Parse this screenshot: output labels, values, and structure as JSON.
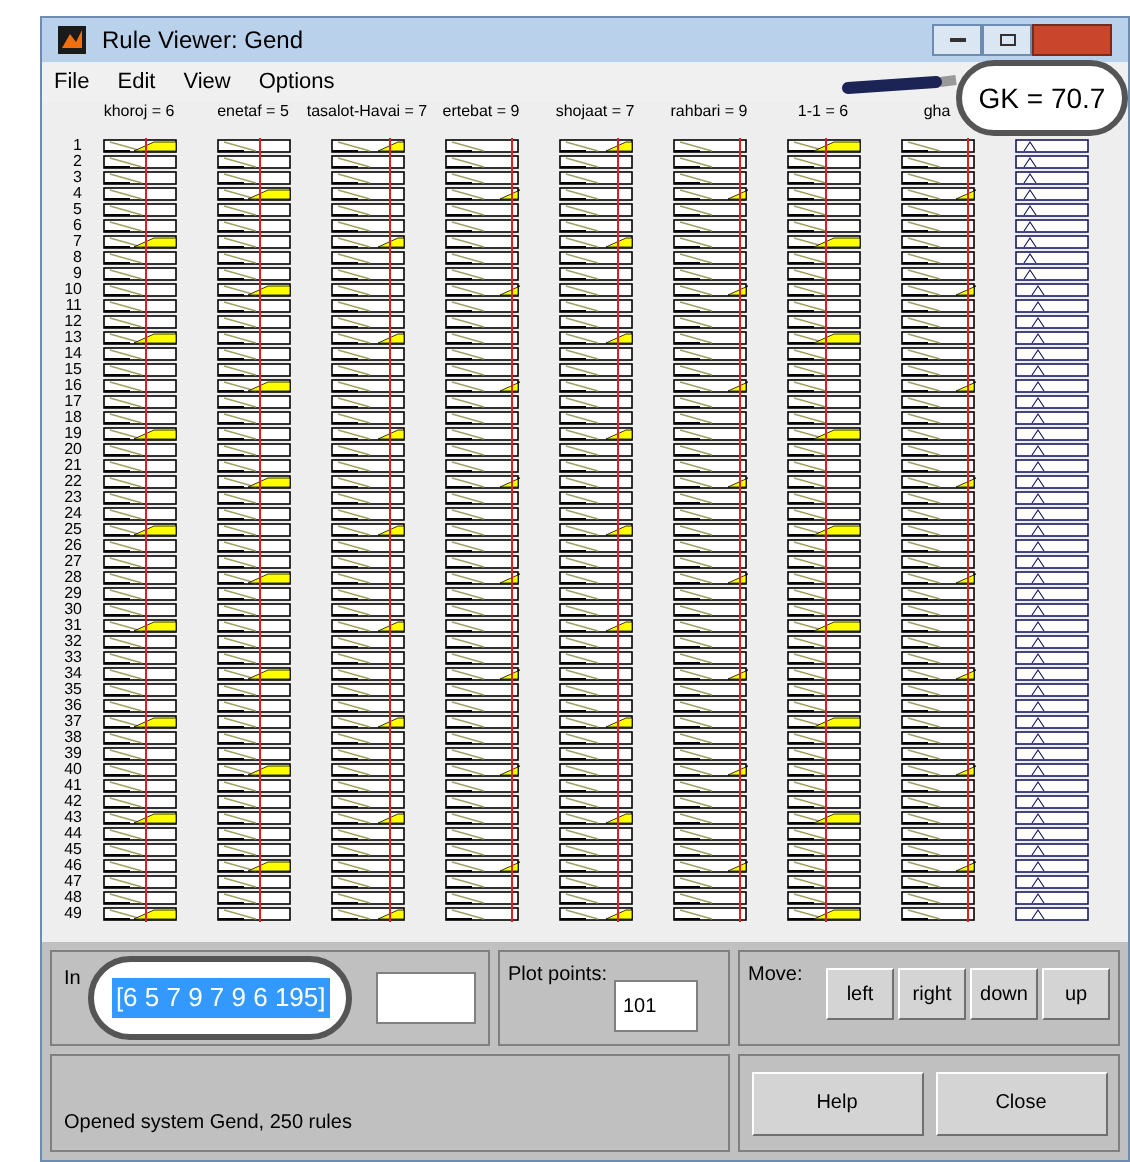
{
  "window": {
    "title": "Rule Viewer: Gend"
  },
  "menu": [
    "File",
    "Edit",
    "View",
    "Options"
  ],
  "inputs": [
    {
      "label": "khoroj = 6"
    },
    {
      "label": "enetaf = 5"
    },
    {
      "label": "tasalot-Havai = 7"
    },
    {
      "label": "ertebat = 9"
    },
    {
      "label": "shojaat = 7"
    },
    {
      "label": "rahbari = 9"
    },
    {
      "label": "1-1 = 6"
    },
    {
      "label": "gha"
    }
  ],
  "output": {
    "label": "GK = 70.7"
  },
  "row_numbers": [
    "1",
    "2",
    "3",
    "4",
    "5",
    "6",
    "7",
    "8",
    "9",
    "10",
    "11",
    "12",
    "13",
    "14",
    "15",
    "16",
    "17",
    "18",
    "19",
    "20",
    "21",
    "22",
    "23",
    "24",
    "25",
    "26",
    "27",
    "28",
    "29",
    "30",
    "31",
    "32",
    "33",
    "34",
    "35",
    "36",
    "37",
    "38",
    "39",
    "40",
    "41",
    "42",
    "43",
    "44",
    "45",
    "46",
    "47",
    "48",
    "49"
  ],
  "input_panel": {
    "label": "In",
    "value": "[6 5 7 9 7 9 6 195]"
  },
  "plot_points": {
    "label": "Plot points:",
    "value": "101"
  },
  "move": {
    "label": "Move:",
    "buttons": [
      "left",
      "right",
      "down",
      "up"
    ]
  },
  "status": "Opened system Gend, 250 rules",
  "buttons": [
    "Help",
    "Close"
  ]
}
